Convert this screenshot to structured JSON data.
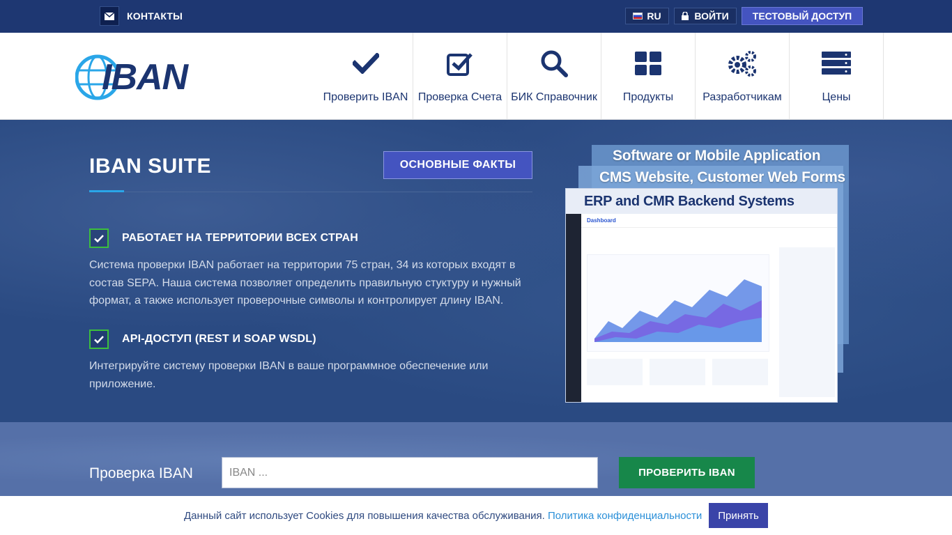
{
  "topbar": {
    "contacts_label": "КОНТАКТЫ",
    "lang_label": "RU",
    "login_label": "ВОЙТИ",
    "test_access_label": "ТЕСТОВЫЙ ДОСТУП"
  },
  "header": {
    "logo_text": "IBAN",
    "nav": [
      {
        "label": "Проверить IBAN",
        "icon": "checkmark-icon"
      },
      {
        "label": "Проверка Счета",
        "icon": "checkbox-icon"
      },
      {
        "label": "БИК Справочник",
        "icon": "search-icon"
      },
      {
        "label": "Продукты",
        "icon": "grid-icon"
      },
      {
        "label": "Разработчикам",
        "icon": "gears-icon"
      },
      {
        "label": "Цены",
        "icon": "server-icon"
      }
    ]
  },
  "hero": {
    "title": "IBAN SUITE",
    "facts_button": "ОСНОВНЫЕ ФАКТЫ",
    "features": [
      {
        "title": "РАБОТАЕТ НА ТЕРРИТОРИИ ВСЕХ СТРАН",
        "text": "Система проверки IBAN работает на территории 75 стран, 34 из которых входят в состав SEPA. Наша система позволяет определить правильную стуктуру и нужный формат, а также использует проверочные символы и контролирует длину IBAN."
      },
      {
        "title": "API-ДОСТУП (REST И SOAP WSDL)",
        "text": "Интегрируйте систему проверки IBAN в ваше программное обеспечение или приложение."
      }
    ],
    "mockup": {
      "label_1": "Software or Mobile Application",
      "label_2": "CMS Website, Customer Web Forms",
      "label_3": "ERP and CMR Backend Systems",
      "dashboard_title": "Dashboard"
    }
  },
  "check": {
    "label": "Проверка IBAN",
    "input_placeholder": "IBAN ...",
    "button": "ПРОВЕРИТЬ IBAN"
  },
  "cookies": {
    "text": "Данный сайт использует Cookies для повышения качества обслуживания.",
    "link": "Политика конфиденциальности",
    "accept": "Принять"
  },
  "colors": {
    "brand": "#1b3470",
    "accent_button": "#4454c0",
    "check_green": "#17874a"
  }
}
